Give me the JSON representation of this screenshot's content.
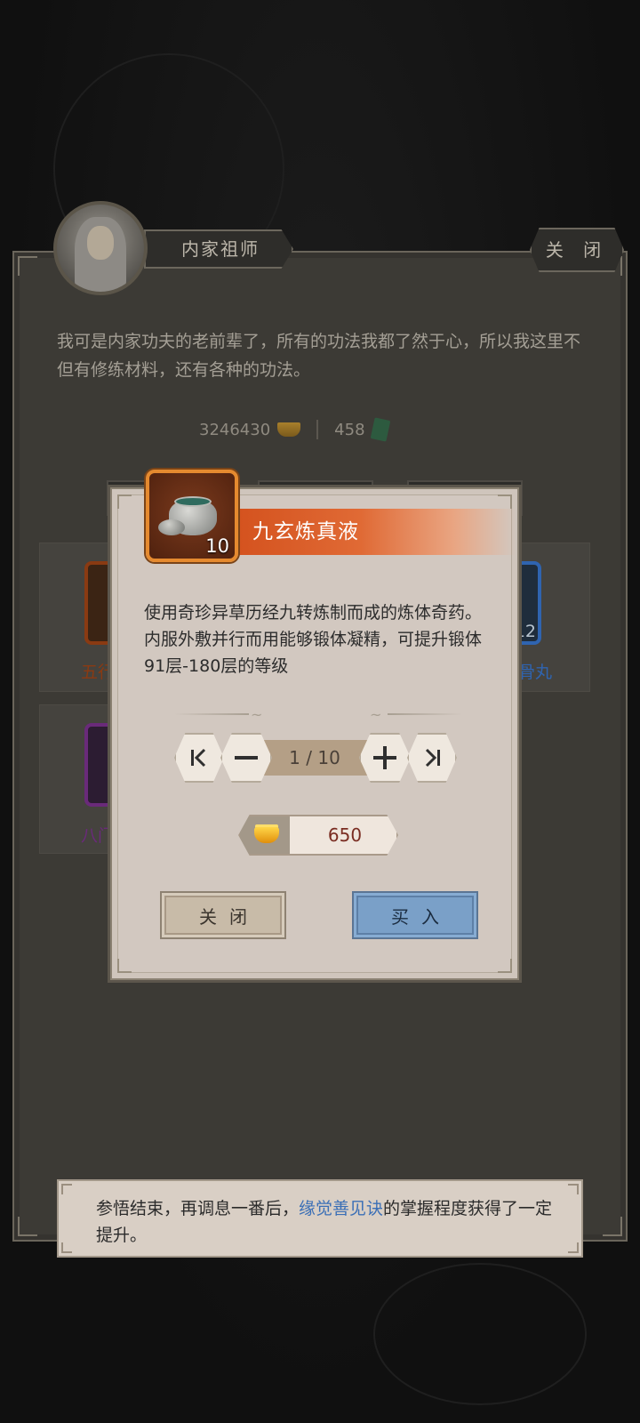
{
  "npc": {
    "name": "内家祖师",
    "close_label": "关 闭",
    "speech": "我可是内家功夫的老前辈了，所有的功法我都了然于心，所以我这里不但有修练材料，还有各种的功法。"
  },
  "currency": {
    "gold_amount": "3246430",
    "gold_icon": "gold-ingot-icon",
    "jade_amount": "458",
    "jade_icon": "jade-token-icon"
  },
  "background_items": [
    {
      "name_fragment": "五行",
      "color": "#8a3a12"
    },
    {
      "name_fragment": "八门",
      "color": "#6a2a7a"
    },
    {
      "name_fragment": "骨丸",
      "count": "12",
      "color": "#2f64b0"
    }
  ],
  "dialog": {
    "item_name": "九玄炼真液",
    "item_icon": "medicine-jar-icon",
    "item_count": "10",
    "description": "使用奇珍异草历经九转炼制而成的炼体奇药。内服外敷并行而用能够锻体凝精，可提升锻体91层-180层的等级",
    "quantity_display": "1 / 10",
    "quantity_current": 1,
    "quantity_max": 10,
    "buttons": {
      "first": "K",
      "minus": "—",
      "plus": "+",
      "last": ">|"
    },
    "price_icon": "gold-ingot-icon",
    "price": "650",
    "close_label": "关闭",
    "buy_label": "买入",
    "colors": {
      "title_bar": "#d4521e",
      "buy_button": "#7aa0c8",
      "price_text": "#7a2d22"
    }
  },
  "toast": {
    "text_before": "参悟结束，再调息一番后，",
    "highlight": "缘觉善见诀",
    "text_after": "的掌握程度获得了一定提升。",
    "highlight_color": "#3b6fb6"
  }
}
